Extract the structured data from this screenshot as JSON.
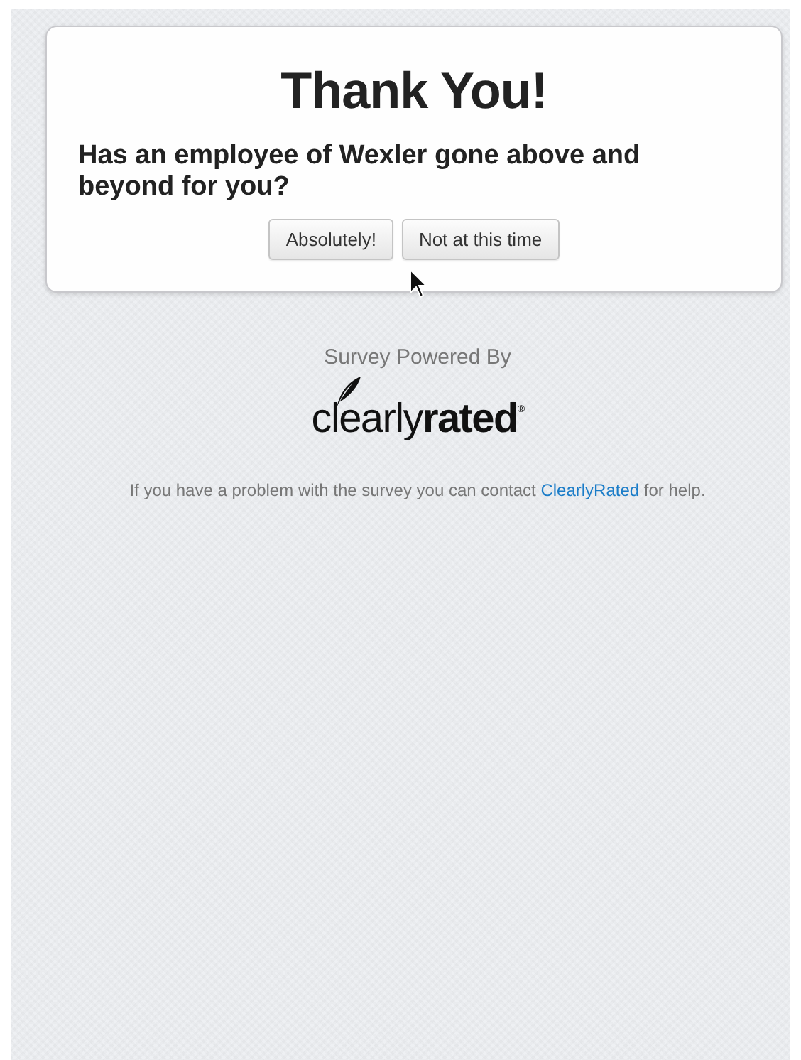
{
  "card": {
    "title": "Thank You!",
    "question": "Has an employee of Wexler gone above and beyond for you?",
    "buttons": [
      "Absolutely!",
      "Not at this time"
    ]
  },
  "powered_by": "Survey Powered By",
  "logo": "clearly**rated**$^{®}$",
  "help": {
    "before": "If you have a problem with the survey you can contact ",
    "link": "ClearlyRated",
    "after": " for help."
  }
}
